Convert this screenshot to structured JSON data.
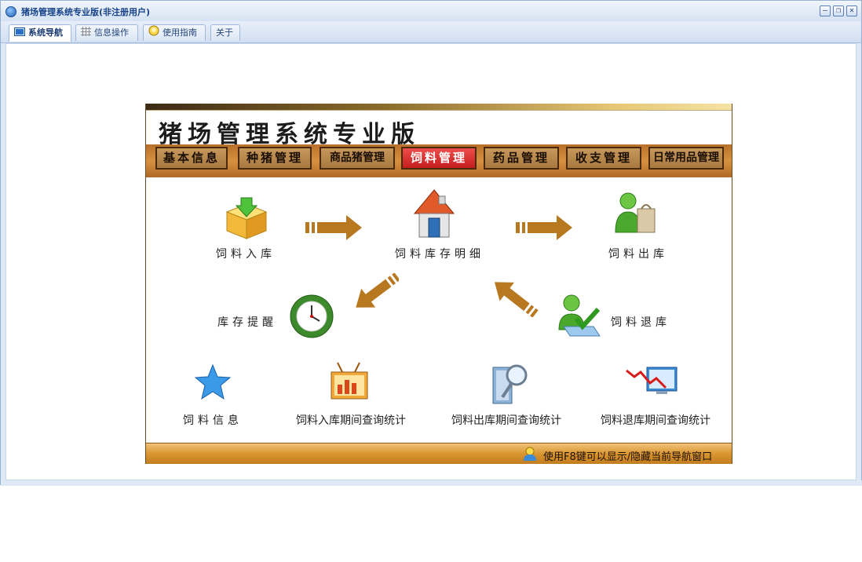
{
  "window": {
    "title": "猪场管理系统专业版(非注册用户)",
    "controls": [
      "–",
      "❐",
      "✕"
    ]
  },
  "tabs": [
    {
      "label": "系统导航",
      "icon": "monitor-icon",
      "active": true
    },
    {
      "label": "信息操作",
      "icon": "grid-icon",
      "active": false
    },
    {
      "label": "使用指南",
      "icon": "lightbulb-icon",
      "active": false
    },
    {
      "label": "关于",
      "icon": "",
      "active": false
    }
  ],
  "panel": {
    "title": "猪场管理系统专业版",
    "menu": [
      {
        "label": "基本信息",
        "active": false
      },
      {
        "label": "种猪管理",
        "active": false
      },
      {
        "label": "商品猪管理",
        "active": false
      },
      {
        "label": "饲料管理",
        "active": true
      },
      {
        "label": "药品管理",
        "active": false
      },
      {
        "label": "收支管理",
        "active": false
      },
      {
        "label": "日常用品管理",
        "active": false
      }
    ],
    "nodes": {
      "feed_in": "饲料入库",
      "feed_stock_detail": "饲料库存明细",
      "feed_out": "饲料出库",
      "stock_reminder": "库存提醒",
      "feed_return": "饲料退库",
      "feed_info": "饲料信息",
      "in_stats": "饲料入库期间查询统计",
      "out_stats": "饲料出库期间查询统计",
      "return_stats": "饲料退库期间查询统计"
    },
    "footer_tip": "使用F8键可以显示/隐藏当前导航窗口"
  },
  "colors": {
    "brand_brown": "#b8702a",
    "active_menu": "#d62a2a",
    "arrow": "#b87820",
    "window_blue": "#dfe8f5"
  }
}
